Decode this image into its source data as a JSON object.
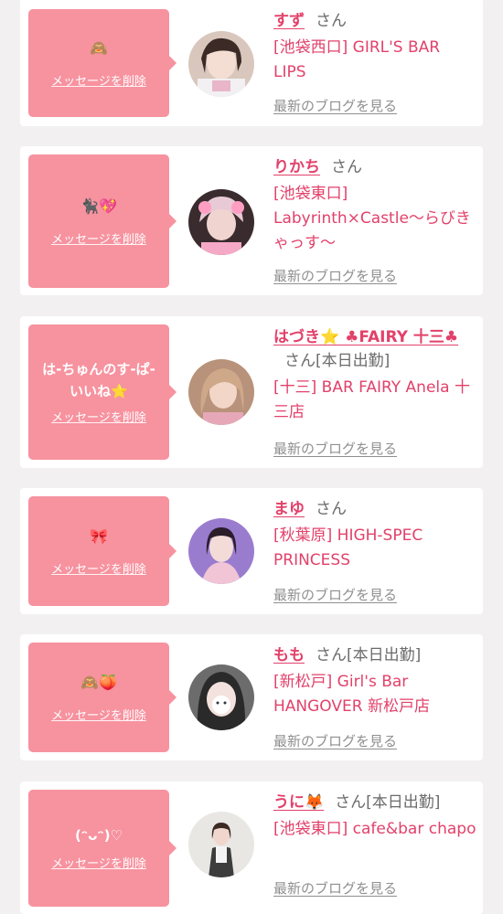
{
  "delete_label": "メッセージを削除",
  "blog_label": "最新のブログを見る",
  "san_label": "さん",
  "colors": {
    "accent": "#e2416a",
    "bubble": "#f7929f",
    "link_gray": "#8f8f8f",
    "background": "#f3f0f1"
  },
  "entries": [
    {
      "message": "🙈",
      "name": "すず",
      "status": "",
      "shop": "[池袋西口] GIRL'S BAR LIPS",
      "avatar_icon": "avatar-suzu"
    },
    {
      "message": "🐈‍⬛💖",
      "name": "りかち",
      "status": "",
      "shop": "[池袋東口] Labyrinth×Castle〜らびきゃっす〜",
      "avatar_icon": "avatar-rikachi"
    },
    {
      "message": "は-ちゅんのす-ぱ-いいね⭐️",
      "name": "はづき⭐️ ♣FAIRY 十三♣",
      "status": "[本日出勤]",
      "shop": "[十三] BAR FAIRY Anela 十三店",
      "avatar_icon": "avatar-hazuki"
    },
    {
      "message": "🎀",
      "name": "まゆ",
      "status": "",
      "shop": "[秋葉原] HIGH-SPEC PRINCESS",
      "avatar_icon": "avatar-mayu"
    },
    {
      "message": "🙈🍑",
      "name": "もも",
      "status": "[本日出勤]",
      "shop": "[新松戸] Girl's Bar HANGOVER 新松戸店",
      "avatar_icon": "avatar-momo"
    },
    {
      "message": "(ᵔᴗᵔ)♡",
      "name": "うに🦊",
      "status": "[本日出勤]",
      "shop": "[池袋東口] cafe&bar chapo",
      "avatar_icon": "avatar-uni"
    }
  ]
}
